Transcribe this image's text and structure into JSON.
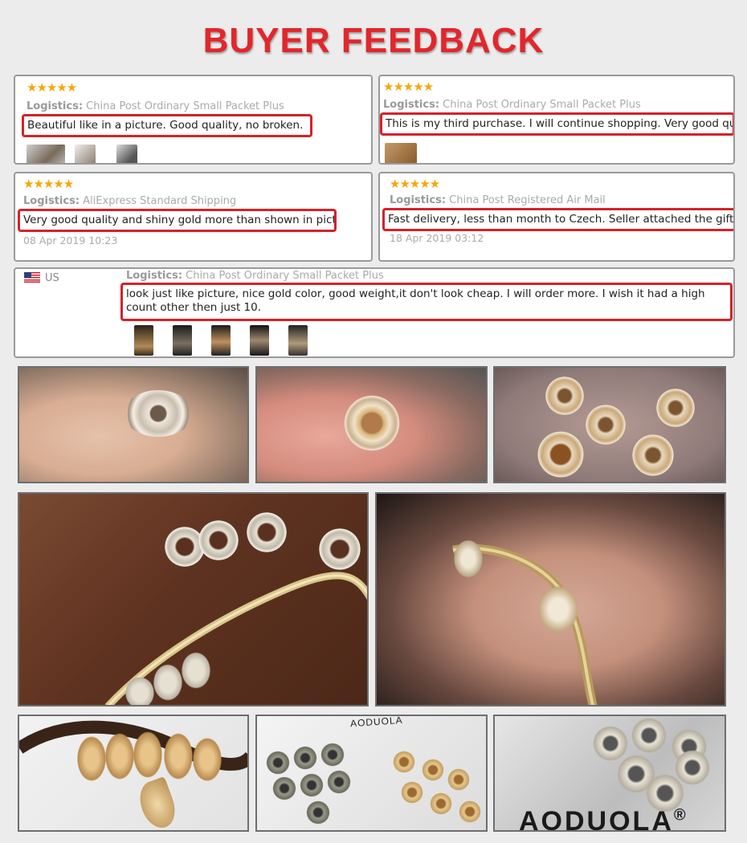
{
  "header": {
    "title": "BUYER FEEDBACK"
  },
  "reviews": [
    {
      "stars": "★★★★★",
      "logistics_label": "Logistics:",
      "logistics_value": "China Post Ordinary Small Packet Plus",
      "text": "Beautiful like in a picture. Good quality, no broken."
    },
    {
      "stars": "★★★★★",
      "logistics_label": "Logistics:",
      "logistics_value": "China Post Ordinary Small Packet Plus",
      "text": "This is my third purchase. I will continue shopping. Very good quality"
    },
    {
      "stars": "★★★★★",
      "logistics_label": "Logistics:",
      "logistics_value": "AliExpress Standard Shipping",
      "text": "Very good quality and shiny gold more than shown in picture",
      "date": "08 Apr 2019 10:23"
    },
    {
      "stars": "★★★★★",
      "logistics_label": "Logistics:",
      "logistics_value": "China Post Registered Air Mail",
      "text": "Fast delivery, less than month to Czech. Seller attached the gift...very ap",
      "date": "18 Apr 2019 03:12"
    },
    {
      "country": "US",
      "logistics_label": "Logistics:",
      "logistics_value": "China Post Ordinary Small Packet Plus",
      "text": "look just like picture, nice gold color, good weight,it don't look cheap. I will order more. I wish it had a high count other then just 10."
    }
  ],
  "photos": {
    "brand_text_1": "AODUOLA",
    "brand_text_2": "AODUOLA",
    "registered_mark": "®"
  },
  "colors": {
    "accent": "#e3262b",
    "highlight_border": "#d4222a",
    "star": "#f7a70a"
  }
}
